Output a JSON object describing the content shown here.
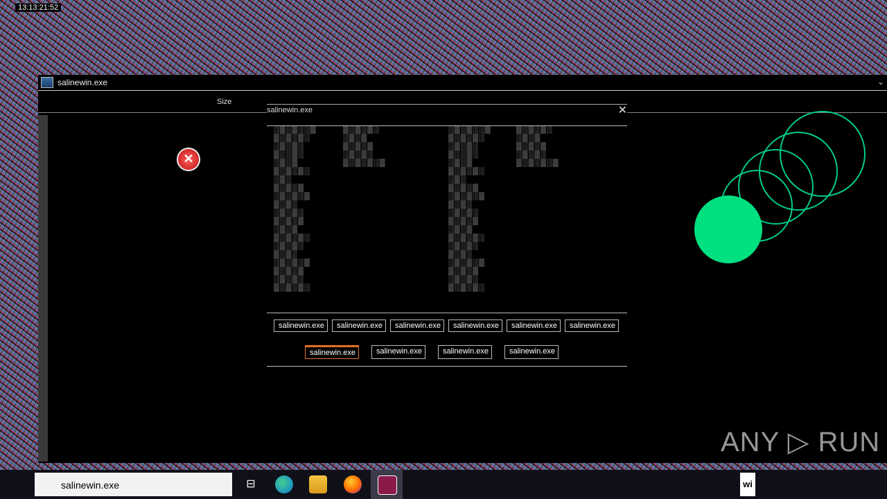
{
  "top_strip": {
    "label": "13:13:21:52"
  },
  "window": {
    "title": "salinewin.exe",
    "size_column": "Size"
  },
  "dialog": {
    "title": "salinewin.exe",
    "close_glyph": "✕",
    "buttons_row1": [
      "salinewin.exe",
      "salinewin.exe",
      "salinewin.exe",
      "salinewin.exe",
      "salinewin.exe",
      "salinewin.exe"
    ],
    "buttons_row2": [
      "salinewin.exe",
      "salinewin.exe",
      "salinewin.exe",
      "salinewin.exe"
    ]
  },
  "taskbar": {
    "search_value": "salinewin.exe",
    "right_label": "wi"
  },
  "watermark": "ANY ▷ RUN",
  "colors": {
    "accent": "#e07020",
    "green": "#00e080"
  }
}
